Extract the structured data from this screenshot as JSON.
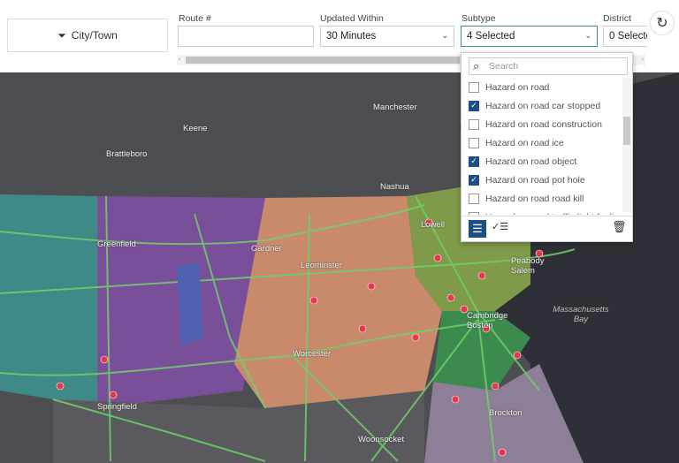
{
  "toolbar": {
    "city_button": "City/Town",
    "route_label": "Route #",
    "route_value": "",
    "updated_label": "Updated Within",
    "updated_value": "30 Minutes",
    "subtype_label": "Subtype",
    "subtype_value": "4 Selected",
    "district_label": "District",
    "district_value": "0 Selecte"
  },
  "dropdown": {
    "search_placeholder": "Search",
    "items": [
      {
        "label": "Hazard on road",
        "checked": false
      },
      {
        "label": "Hazard on road car stopped",
        "checked": true
      },
      {
        "label": "Hazard on road construction",
        "checked": false
      },
      {
        "label": "Hazard on road ice",
        "checked": false
      },
      {
        "label": "Hazard on road object",
        "checked": true
      },
      {
        "label": "Hazard on road pot hole",
        "checked": true
      },
      {
        "label": "Hazard on road road kill",
        "checked": false
      },
      {
        "label": "Hazard on road traffic light fault",
        "checked": false
      }
    ]
  },
  "map": {
    "labels": [
      "Manchester",
      "Keene",
      "Brattleboro",
      "Nashua",
      "Lowell",
      "Greenfield",
      "Gardner",
      "Leominster",
      "Peabody Salem",
      "Cambridge Boston",
      "Massachusetts Bay",
      "Worcester",
      "Springfield",
      "Brockton",
      "Woonsocket"
    ]
  },
  "colors": {
    "accent": "#1e4f84",
    "roads": "#6fd06a",
    "incident": "#e8364f"
  }
}
